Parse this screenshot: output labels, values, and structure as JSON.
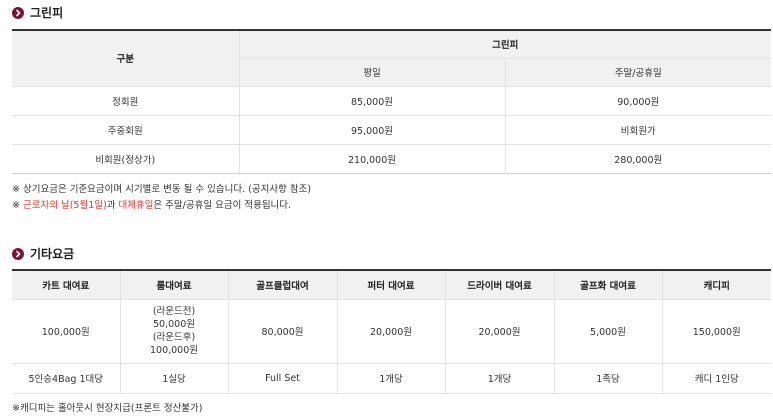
{
  "greenfee": {
    "title": "그린피",
    "header": {
      "category": "구분",
      "group": "그린피",
      "weekday": "평일",
      "weekend": "주말/공휴일"
    },
    "rows": [
      {
        "label": "정회원",
        "weekday": "85,000원",
        "weekend": "90,000원"
      },
      {
        "label": "주중회원",
        "weekday": "95,000원",
        "weekend": "비회원가"
      },
      {
        "label": "비회원(정상가)",
        "weekday": "210,000원",
        "weekend": "280,000원"
      }
    ],
    "note1": "※ 상기요금은 기준요금이며 시기별로 변동 될 수 있습니다. (공지사항 참조)",
    "note2": {
      "prefix": "※ ",
      "highlight1": "근로자의 날(5월1일)",
      "mid": "과 ",
      "highlight2": "대체휴일",
      "suffix": "은 주말/공휴일 요금이 적용됩니다."
    }
  },
  "otherfee": {
    "title": "기타요금",
    "headers": [
      "카트 대여료",
      "룸대여료",
      "골프클럽대여",
      "퍼터 대여료",
      "드라이버 대여료",
      "골프화 대여료",
      "캐디피"
    ],
    "prices": {
      "cart": "100,000원",
      "room": [
        "(라운드전)",
        "50,000원",
        "(라운드후)",
        "100,000원"
      ],
      "club": "80,000원",
      "putter": "20,000원",
      "driver": "20,000원",
      "shoes": "5,000원",
      "caddie": "150,000원"
    },
    "units": [
      "5인승4Bag 1대당",
      "1실당",
      "Full Set",
      "1개당",
      "1개당",
      "1족당",
      "캐디 1인당"
    ],
    "note": "※캐디피는 홀아웃시 현장지급(프론트 정산불가)"
  },
  "colors": {
    "accent": "#7a1531",
    "highlight": "#e0322a",
    "header_bg": "#f1f1f1"
  },
  "icons": {
    "title": "circle-arrow-icon"
  }
}
